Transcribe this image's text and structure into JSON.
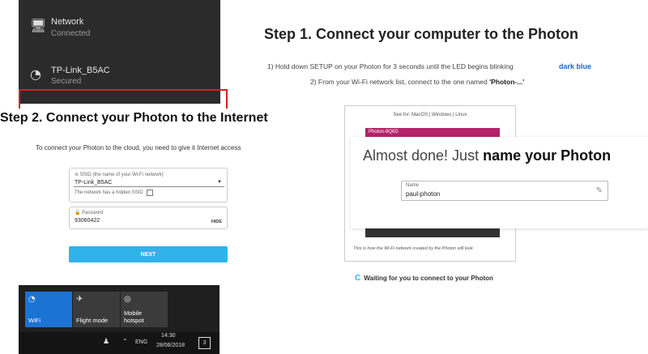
{
  "network_panel": {
    "rows": [
      {
        "icon": "desktop-icon",
        "name": "Network",
        "status": "Connected"
      },
      {
        "icon": "wifi-icon",
        "name": "TP-Link_B5AC",
        "status": "Secured"
      }
    ]
  },
  "step1": {
    "title": "Step 1. Connect your computer to the Photon",
    "line1": "1) Hold down SETUP on your Photon for 3 seconds until the LED begins blinking",
    "line1_highlight": "dark blue",
    "line2_prefix": "2) From your Wi-Fi network list, connect to the one named ",
    "line2_bold": "'Photon-...'"
  },
  "step2": {
    "title": "Step 2. Connect your Photon to the Internet",
    "subtitle": "To connect your Photon to the cloud, you need to give it Internet access",
    "ssid_label": "SSID (the name of your Wi-Fi network)",
    "ssid_value": "TP-Link_B5AC",
    "hidden_ssid_label": "The network has a hidden SSID",
    "password_label": "Password",
    "password_value": "93060422",
    "hide_label": "HIDE",
    "next_label": "NEXT"
  },
  "setup_page": {
    "tabs": "See for: MacOS | Windows | Linux",
    "bar_text": "Photon-9Q6D",
    "caption": "This is how the Wi-Fi network created by the Photon will look",
    "overlay_heading_light": "Almost done! Just ",
    "overlay_heading_bold": "name your Photon",
    "name_label": "Name",
    "name_value": "paul-photon",
    "waiting_text": "Waiting for you to connect to your Photon"
  },
  "quick_actions": {
    "tiles": [
      {
        "icon": "wifi-icon",
        "label": "WiFi"
      },
      {
        "icon": "airplane-icon",
        "label": "Flight mode"
      },
      {
        "icon": "hotspot-icon",
        "label": "Mobile hotspot"
      }
    ],
    "taskbar": {
      "language": "ENG",
      "time": "14:30",
      "date": "28/06/2018",
      "notification_count": "3"
    }
  },
  "colors": {
    "accent_blue": "#2fb3ea",
    "highlight_blue": "#1e66c7",
    "photon_bar": "#b3236b",
    "red_outline": "#d61f1f"
  }
}
